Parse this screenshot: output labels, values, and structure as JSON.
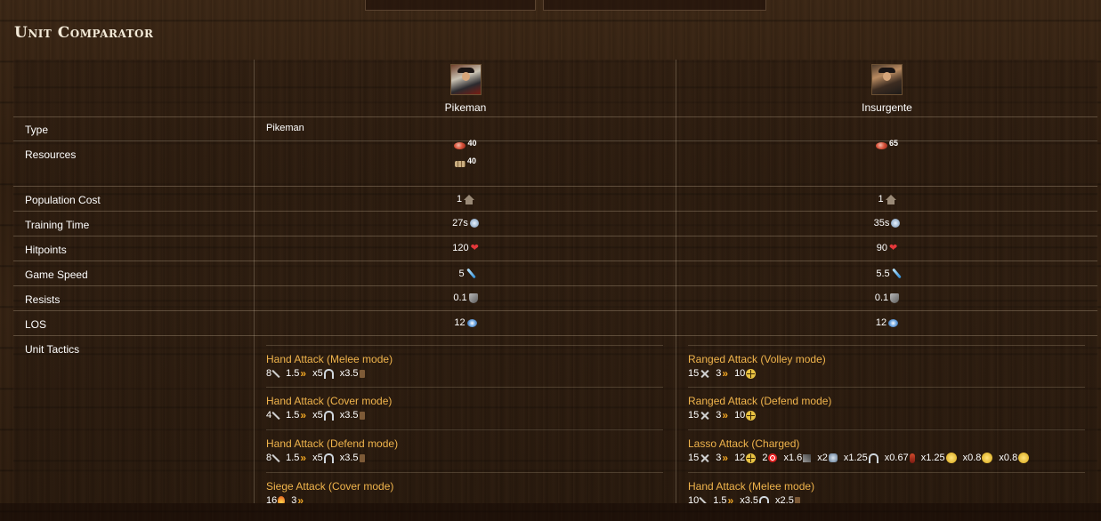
{
  "page": {
    "title": "Unit Comparator"
  },
  "units": [
    {
      "name": "Pikeman"
    },
    {
      "name": "Insurgente"
    }
  ],
  "rows": {
    "type": {
      "label": "Type",
      "u1": "Pikeman",
      "u2": ""
    },
    "resources": {
      "label": "Resources",
      "u1_food": "40",
      "u1_wood": "40",
      "u2_food": "65"
    },
    "population": {
      "label": "Population Cost",
      "u1": "1",
      "u2": "1"
    },
    "training": {
      "label": "Training Time",
      "u1": "27s",
      "u2": "35s"
    },
    "hitpoints": {
      "label": "Hitpoints",
      "u1": "120",
      "u2": "90"
    },
    "speed": {
      "label": "Game Speed",
      "u1": "5",
      "u2": "5.5"
    },
    "resists": {
      "label": "Resists",
      "u1": "0.1",
      "u2": "0.1"
    },
    "los": {
      "label": "LOS",
      "u1": "12",
      "u2": "12"
    },
    "tactics": {
      "label": "Unit Tactics"
    }
  },
  "tactics_u1": [
    {
      "name": "Hand Attack (Melee mode)",
      "damage": "8",
      "rof": "1.5",
      "vs_cav": "x5",
      "vs_boot": "x3.5"
    },
    {
      "name": "Hand Attack (Cover mode)",
      "damage": "4",
      "rof": "1.5",
      "vs_cav": "x5",
      "vs_boot": "x3.5"
    },
    {
      "name": "Hand Attack (Defend mode)",
      "damage": "8",
      "rof": "1.5",
      "vs_cav": "x5",
      "vs_boot": "x3.5"
    },
    {
      "name": "Siege Attack (Cover mode)",
      "damage": "16",
      "rof": "3"
    }
  ],
  "tactics_u2": [
    {
      "name": "Ranged Attack (Volley mode)",
      "damage": "15",
      "rof": "3",
      "range": "10"
    },
    {
      "name": "Ranged Attack (Defend mode)",
      "damage": "15",
      "rof": "3",
      "range": "10"
    },
    {
      "name": "Lasso Attack (Charged)",
      "damage": "15",
      "rof": "3",
      "range": "12",
      "area": "2",
      "m_art": "x1.6",
      "m_cav": "x2",
      "m_cav_label": "x1.25",
      "m_horse": "x0.67",
      "m_inf": "x1.25",
      "m_coin1": "x0.8",
      "m_coin2": "x0.8"
    },
    {
      "name": "Hand Attack (Melee mode)",
      "damage": "10",
      "rof": "1.5",
      "vs_cav": "x3.5",
      "vs_boot": "x2.5"
    }
  ],
  "colors": {
    "tactic_name": "#f0b44c",
    "chevron": "#f0a623",
    "heart": "#e5383b"
  }
}
